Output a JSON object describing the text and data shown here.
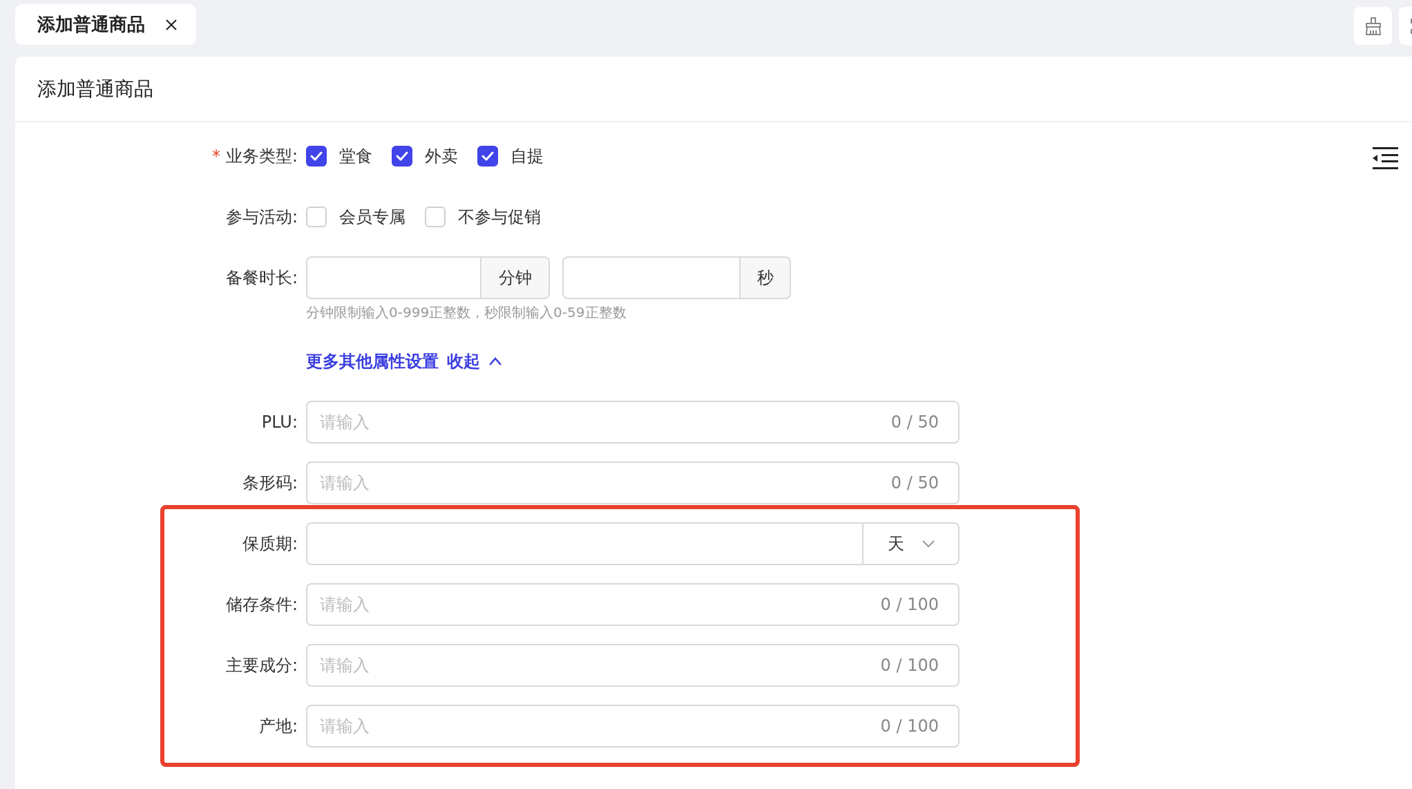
{
  "tab": {
    "label": "添加普通商品",
    "selected": true
  },
  "page_title": "添加普通商品",
  "form": {
    "rows": [
      {
        "kind": "checkboxes",
        "label": "业务类型:",
        "required_mark": "*",
        "highlighted": false,
        "options": [
          {
            "label": "堂食",
            "checked": true
          },
          {
            "label": "外卖",
            "checked": true
          },
          {
            "label": "自提",
            "checked": true
          }
        ]
      },
      {
        "kind": "checkboxes",
        "label": "参与活动:",
        "highlighted": false,
        "options": [
          {
            "label": "会员专属",
            "checked": false
          },
          {
            "label": "不参与促销",
            "checked": false
          }
        ]
      },
      {
        "kind": "duration",
        "label": "备餐时长:",
        "highlighted": false,
        "units": [
          "分钟",
          "秒"
        ],
        "hint": "分钟限制输入0-999正整数，秒限制输入0-59正整数"
      },
      {
        "kind": "link",
        "text": "更多其他属性设置",
        "toggle": "收起",
        "expanded": true,
        "highlighted": false
      },
      {
        "kind": "text",
        "label": "PLU:",
        "highlighted": false,
        "placeholder": "请输入",
        "counter": "0 / 50"
      },
      {
        "kind": "text",
        "label": "条形码:",
        "highlighted": false,
        "placeholder": "请输入",
        "counter": "0 / 50"
      },
      {
        "kind": "select",
        "label": "保质期:",
        "highlighted": true,
        "unit": "天"
      },
      {
        "kind": "text",
        "label": "储存条件:",
        "highlighted": true,
        "placeholder": "请输入",
        "counter": "0 / 100"
      },
      {
        "kind": "text",
        "label": "主要成分:",
        "highlighted": true,
        "placeholder": "请输入",
        "counter": "0 / 100"
      },
      {
        "kind": "text",
        "label": "产地:",
        "highlighted": true,
        "placeholder": "请输入",
        "counter": "0 / 100"
      }
    ]
  }
}
